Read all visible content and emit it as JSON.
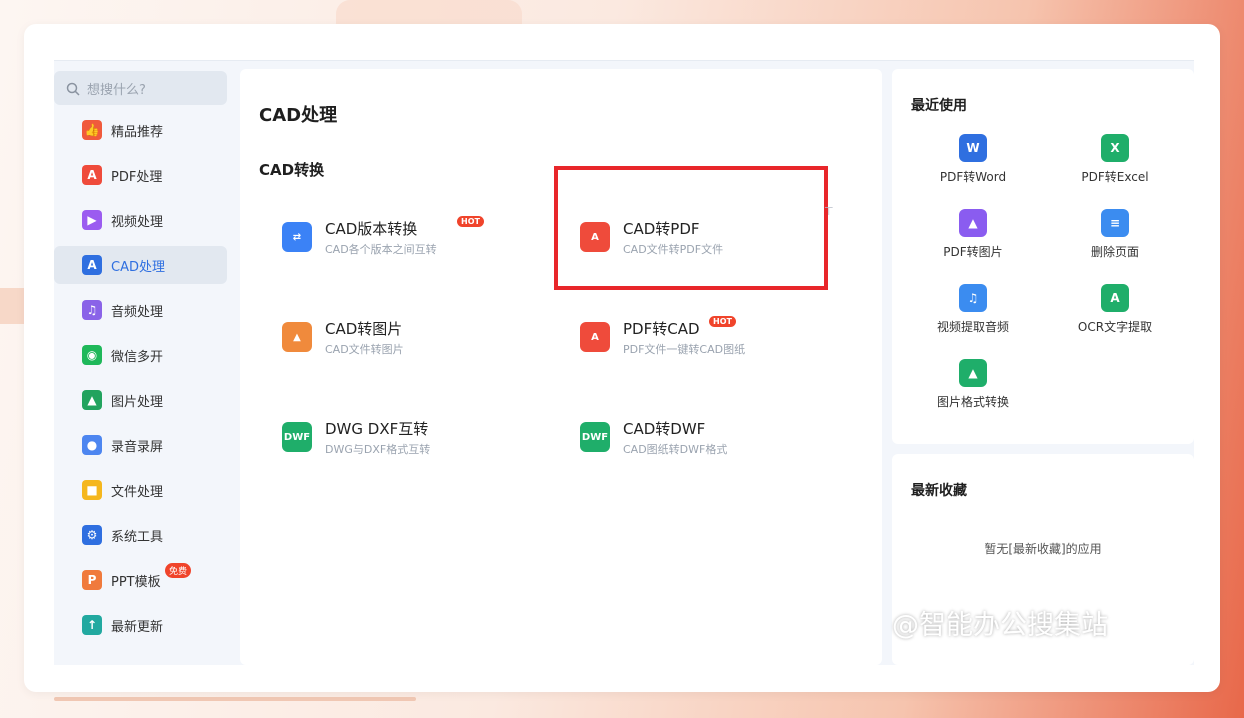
{
  "search": {
    "placeholder": "想搜什么?"
  },
  "sidebar": {
    "items": [
      {
        "label": "精品推荐",
        "icon": "thumbs-up-icon",
        "color": "#f05a3c",
        "glyph": "👍"
      },
      {
        "label": "PDF处理",
        "icon": "pdf-icon",
        "color": "#ef4b3b",
        "glyph": "A"
      },
      {
        "label": "视频处理",
        "icon": "video-play-icon",
        "color": "#9b5cf0",
        "glyph": "▶"
      },
      {
        "label": "CAD处理",
        "icon": "cad-icon",
        "color": "#2f6fe0",
        "glyph": "A"
      },
      {
        "label": "音频处理",
        "icon": "music-note-icon",
        "color": "#8a63e8",
        "glyph": "♫"
      },
      {
        "label": "微信多开",
        "icon": "wechat-icon",
        "color": "#1fb85a",
        "glyph": "◉"
      },
      {
        "label": "图片处理",
        "icon": "image-icon",
        "color": "#22a35e",
        "glyph": "▲"
      },
      {
        "label": "录音录屏",
        "icon": "microphone-icon",
        "color": "#4d86f0",
        "glyph": "●"
      },
      {
        "label": "文件处理",
        "icon": "folder-icon",
        "color": "#f5b71d",
        "glyph": "■"
      },
      {
        "label": "系统工具",
        "icon": "gear-icon",
        "color": "#2f6fe0",
        "glyph": "⚙"
      },
      {
        "label": "PPT模板",
        "icon": "ppt-icon",
        "color": "#f07a3c",
        "glyph": "P",
        "badge": "免费"
      },
      {
        "label": "最新更新",
        "icon": "upload-icon",
        "color": "#22a9a0",
        "glyph": "↑"
      }
    ]
  },
  "main": {
    "title": "CAD处理",
    "section": "CAD转换",
    "tools": [
      {
        "name": "CAD版本转换",
        "desc": "CAD各个版本之间互转",
        "hot": "HOT",
        "icon": "version-convert-icon",
        "color": "#3b82f6",
        "glyph": "⇄"
      },
      {
        "name": "CAD转PDF",
        "desc": "CAD文件转PDF文件",
        "icon": "cad-to-pdf-icon",
        "color": "#ef4b3b",
        "glyph": "A"
      },
      {
        "name": "CAD转图片",
        "desc": "CAD文件转图片",
        "icon": "cad-to-image-icon",
        "color": "#f08a3c",
        "glyph": "▲"
      },
      {
        "name": "PDF转CAD",
        "desc": "PDF文件一键转CAD图纸",
        "hot": "HOT",
        "icon": "pdf-to-cad-icon",
        "color": "#ef4b3b",
        "glyph": "A"
      },
      {
        "name": "DWG DXF互转",
        "desc": "DWG与DXF格式互转",
        "icon": "dwg-dxf-icon",
        "color": "#1fae6a",
        "glyph": "DWF"
      },
      {
        "name": "CAD转DWF",
        "desc": "CAD图纸转DWF格式",
        "icon": "cad-to-dwf-icon",
        "color": "#1fae6a",
        "glyph": "DWF"
      }
    ]
  },
  "recent": {
    "title": "最近使用",
    "items": [
      {
        "label": "PDF转Word",
        "icon": "pdf-to-word-icon",
        "color": "#2f6fe0",
        "glyph": "W"
      },
      {
        "label": "PDF转Excel",
        "icon": "pdf-to-excel-icon",
        "color": "#1fae6a",
        "glyph": "X"
      },
      {
        "label": "PDF转图片",
        "icon": "pdf-to-image-icon",
        "color": "#8a5cf0",
        "glyph": "▲"
      },
      {
        "label": "删除页面",
        "icon": "delete-page-icon",
        "color": "#3b8cf0",
        "glyph": "≡"
      },
      {
        "label": "视频提取音频",
        "icon": "extract-audio-icon",
        "color": "#3b8cf0",
        "glyph": "♫"
      },
      {
        "label": "OCR文字提取",
        "icon": "ocr-icon",
        "color": "#1fae6a",
        "glyph": "A"
      },
      {
        "label": "图片格式转换",
        "icon": "image-format-icon",
        "color": "#1fae6a",
        "glyph": "▲"
      }
    ]
  },
  "favorites": {
    "title": "最新收藏",
    "empty": "暂无[最新收藏]的应用"
  },
  "watermark": "@智能办公搜集站"
}
